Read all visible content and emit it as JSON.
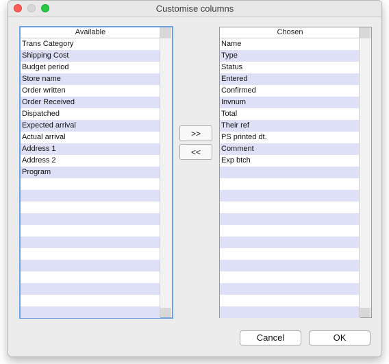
{
  "window": {
    "title": "Customise columns"
  },
  "available": {
    "header": "Available",
    "items": [
      "Trans Category",
      "Shipping Cost",
      "Budget period",
      "Store name",
      "Order written",
      "Order Received",
      "Dispatched",
      "Expected arrival",
      "Actual arrival",
      "Address 1",
      "Address 2",
      "Program",
      "",
      "",
      "",
      "",
      "",
      "",
      "",
      "",
      "",
      "",
      "",
      ""
    ]
  },
  "chosen": {
    "header": "Chosen",
    "items": [
      "Name",
      "Type",
      "Status",
      "Entered",
      "Confirmed",
      "Invnum",
      "Total",
      "Their ref",
      "PS printed dt.",
      "Comment",
      "Exp btch",
      "",
      "",
      "",
      "",
      "",
      "",
      "",
      "",
      "",
      "",
      "",
      "",
      ""
    ]
  },
  "move": {
    "add_label": ">>",
    "remove_label": "<<"
  },
  "buttons": {
    "cancel": "Cancel",
    "ok": "OK"
  },
  "colors": {
    "stripe": "#dde0f6",
    "focus_ring": "#6ea3e3",
    "close": "#fe5f57",
    "minimize": "#d7d7d7",
    "maximize": "#28c840"
  }
}
